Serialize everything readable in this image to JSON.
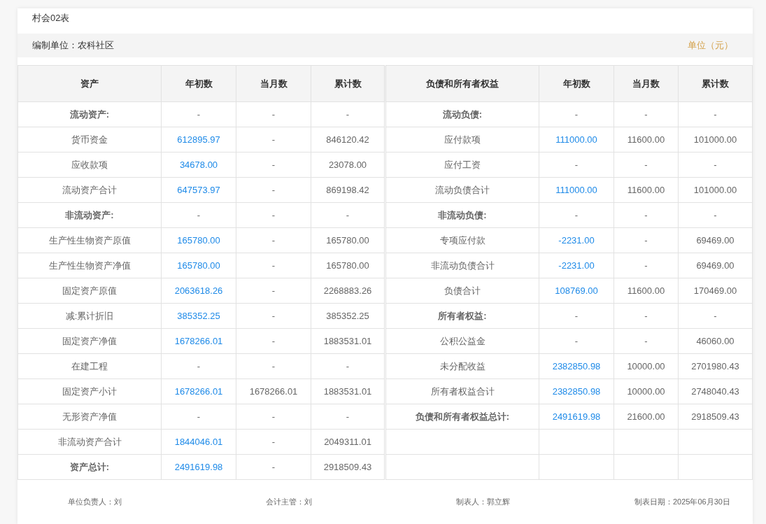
{
  "title": "村会02表",
  "unit_info": {
    "org_label": "编制单位：农科社区",
    "unit": "单位（元）"
  },
  "table": {
    "columns": [
      "资产",
      "年初数",
      "当月数",
      "累计数",
      "负债和所有者权益",
      "年初数",
      "当月数",
      "累计数"
    ],
    "rows": [
      {
        "left": {
          "label": "流动资产:",
          "kind": "heading",
          "linked": false,
          "values": [
            "-",
            "-",
            "-"
          ]
        },
        "right": {
          "label": "流动负债:",
          "kind": "heading",
          "linked": false,
          "values": [
            "-",
            "-",
            "-"
          ]
        }
      },
      {
        "left": {
          "label": "货币资金",
          "kind": "item",
          "linked": true,
          "values": [
            "612895.97",
            "-",
            "846120.42"
          ]
        },
        "right": {
          "label": "应付款项",
          "kind": "item",
          "linked": true,
          "values": [
            "111000.00",
            "11600.00",
            "101000.00"
          ]
        }
      },
      {
        "left": {
          "label": "应收款项",
          "kind": "item",
          "linked": true,
          "values": [
            "34678.00",
            "-",
            "23078.00"
          ]
        },
        "right": {
          "label": "应付工资",
          "kind": "item",
          "linked": false,
          "values": [
            "-",
            "-",
            "-"
          ]
        }
      },
      {
        "left": {
          "label": "流动资产合计",
          "kind": "item",
          "linked": true,
          "values": [
            "647573.97",
            "-",
            "869198.42"
          ]
        },
        "right": {
          "label": "流动负债合计",
          "kind": "item",
          "linked": true,
          "values": [
            "111000.00",
            "11600.00",
            "101000.00"
          ]
        }
      },
      {
        "left": {
          "label": "非流动资产:",
          "kind": "heading",
          "linked": false,
          "values": [
            "-",
            "-",
            "-"
          ]
        },
        "right": {
          "label": "非流动负债:",
          "kind": "heading",
          "linked": false,
          "values": [
            "-",
            "-",
            "-"
          ]
        }
      },
      {
        "left": {
          "label": "生产性生物资产原值",
          "kind": "item",
          "linked": true,
          "values": [
            "165780.00",
            "-",
            "165780.00"
          ]
        },
        "right": {
          "label": "专项应付款",
          "kind": "item",
          "linked": true,
          "values": [
            "-2231.00",
            "-",
            "69469.00"
          ]
        }
      },
      {
        "left": {
          "label": "生产性生物资产净值",
          "kind": "item",
          "linked": true,
          "values": [
            "165780.00",
            "-",
            "165780.00"
          ]
        },
        "right": {
          "label": "非流动负债合计",
          "kind": "item",
          "linked": true,
          "values": [
            "-2231.00",
            "-",
            "69469.00"
          ]
        }
      },
      {
        "left": {
          "label": "固定资产原值",
          "kind": "item",
          "linked": true,
          "values": [
            "2063618.26",
            "-",
            "2268883.26"
          ]
        },
        "right": {
          "label": "负债合计",
          "kind": "item",
          "linked": true,
          "values": [
            "108769.00",
            "11600.00",
            "170469.00"
          ]
        }
      },
      {
        "left": {
          "label": "减:累计折旧",
          "kind": "item",
          "linked": true,
          "values": [
            "385352.25",
            "-",
            "385352.25"
          ]
        },
        "right": {
          "label": "所有者权益:",
          "kind": "heading",
          "linked": false,
          "values": [
            "-",
            "-",
            "-"
          ]
        }
      },
      {
        "left": {
          "label": "固定资产净值",
          "kind": "item",
          "linked": true,
          "values": [
            "1678266.01",
            "-",
            "1883531.01"
          ]
        },
        "right": {
          "label": "公积公益金",
          "kind": "item",
          "linked": false,
          "values": [
            "-",
            "-",
            "46060.00"
          ]
        }
      },
      {
        "left": {
          "label": "在建工程",
          "kind": "item",
          "linked": false,
          "values": [
            "-",
            "-",
            "-"
          ]
        },
        "right": {
          "label": "未分配收益",
          "kind": "item",
          "linked": true,
          "values": [
            "2382850.98",
            "10000.00",
            "2701980.43"
          ]
        }
      },
      {
        "left": {
          "label": "固定资产小计",
          "kind": "item",
          "linked": true,
          "values": [
            "1678266.01",
            "1678266.01",
            "1883531.01"
          ]
        },
        "right": {
          "label": "所有者权益合计",
          "kind": "item",
          "linked": true,
          "values": [
            "2382850.98",
            "10000.00",
            "2748040.43"
          ]
        }
      },
      {
        "left": {
          "label": "无形资产净值",
          "kind": "item",
          "linked": false,
          "values": [
            "-",
            "-",
            "-"
          ]
        },
        "right": {
          "label": "负债和所有者权益总计:",
          "kind": "heading",
          "linked": true,
          "values": [
            "2491619.98",
            "21600.00",
            "2918509.43"
          ]
        }
      },
      {
        "left": {
          "label": "非流动资产合计",
          "kind": "item",
          "linked": true,
          "values": [
            "1844046.01",
            "-",
            "2049311.01"
          ]
        }
      },
      {
        "left": {
          "label": "资产总计:",
          "kind": "heading",
          "linked": true,
          "values": [
            "2491619.98",
            "-",
            "2918509.43"
          ]
        }
      }
    ]
  },
  "footer": [
    "单位负责人：刘",
    "会计主管：刘",
    "制表人：郭立辉",
    "制表日期：2025年06月30日"
  ]
}
